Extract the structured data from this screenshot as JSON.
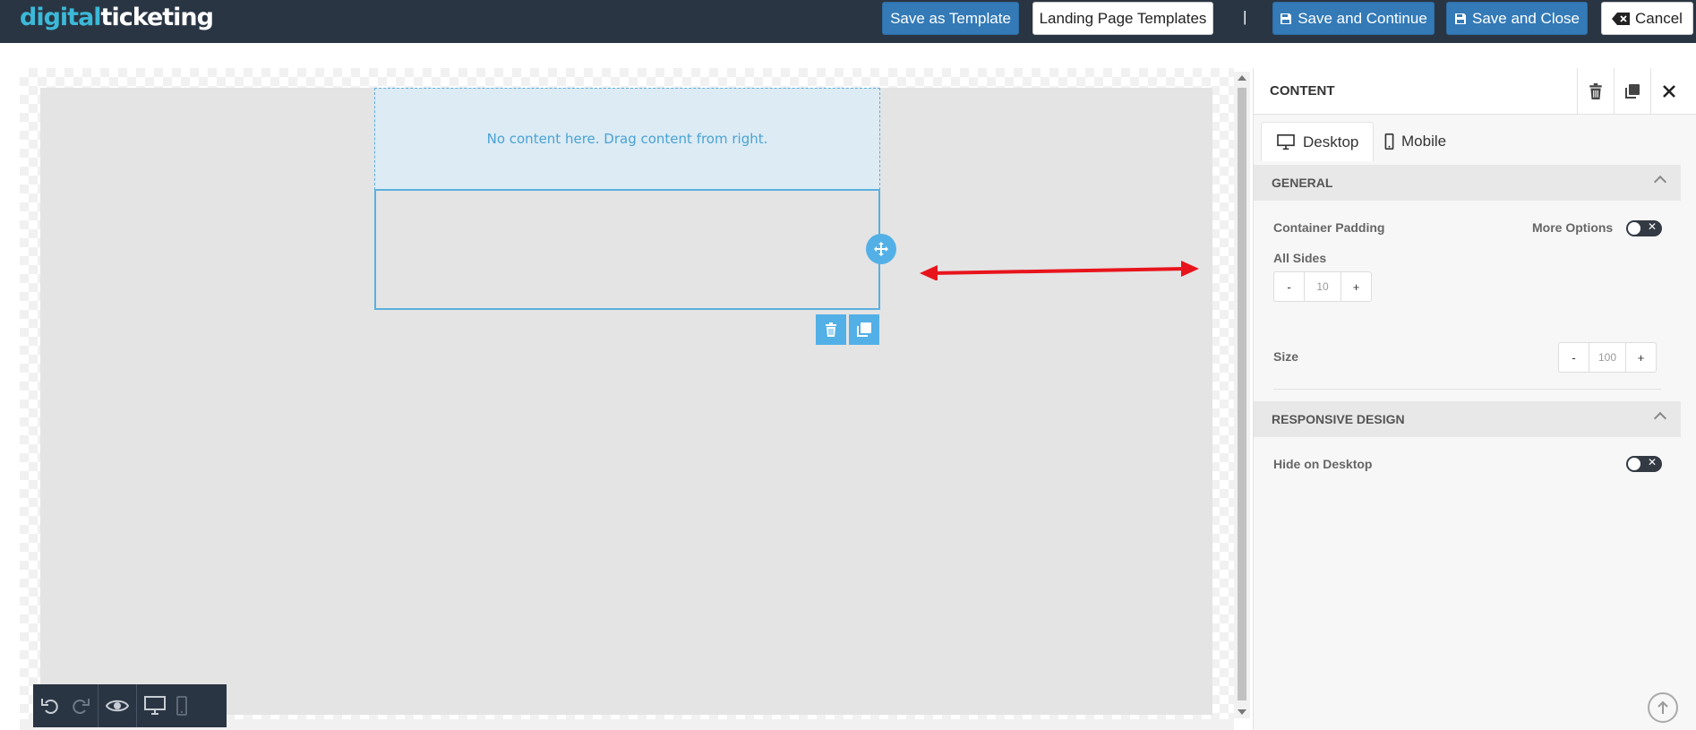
{
  "header": {
    "logo_part1": "digital",
    "logo_part2": "ticketing",
    "save_as_template": "Save as Template",
    "landing_page_templates": "Landing Page Templates",
    "separator": "|",
    "save_and_continue": "Save and Continue",
    "save_and_close": "Save and Close",
    "cancel": "Cancel"
  },
  "canvas": {
    "empty_message": "No content here. Drag content from right."
  },
  "panel": {
    "title": "CONTENT",
    "tabs": [
      {
        "label": "Desktop",
        "icon": "desktop-icon",
        "active": true
      },
      {
        "label": "Mobile",
        "icon": "mobile-icon",
        "active": false
      }
    ],
    "general": {
      "heading": "GENERAL",
      "container_padding_label": "Container Padding",
      "more_options_label": "More Options",
      "more_options_enabled": false,
      "all_sides_label": "All Sides",
      "padding_minus": "-",
      "padding_value": "10",
      "padding_plus": "+",
      "size_label": "Size",
      "size_minus": "-",
      "size_value": "100",
      "size_plus": "+"
    },
    "responsive": {
      "heading": "RESPONSIVE DESIGN",
      "hide_on_desktop_label": "Hide on Desktop",
      "hide_on_desktop_enabled": false
    }
  },
  "colors": {
    "topbar": "#2a3543",
    "primary_button": "#337ab7",
    "accent": "#52b0e6",
    "arrow_annotation": "#e8141c"
  }
}
